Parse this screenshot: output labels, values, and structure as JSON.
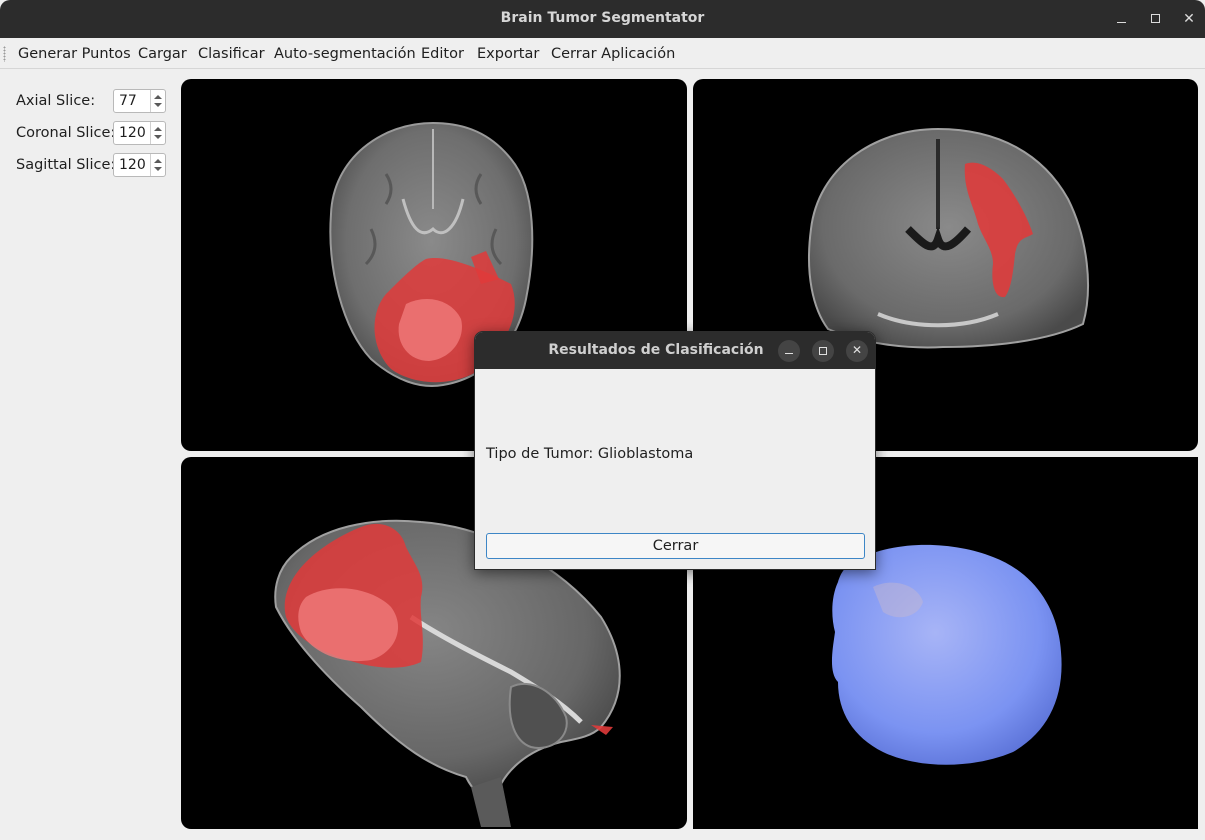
{
  "window": {
    "title": "Brain Tumor Segmentator"
  },
  "menu": {
    "items": [
      "Generar Puntos",
      "Cargar",
      "Clasificar",
      "Auto-segmentación",
      "Editor",
      "Exportar",
      "Cerrar Aplicación"
    ]
  },
  "sidebar": {
    "axial": {
      "label": "Axial Slice:",
      "value": "77"
    },
    "coronal": {
      "label": "Coronal Slice:",
      "value": "120"
    },
    "sagittal": {
      "label": "Sagittal Slice:",
      "value": "120"
    }
  },
  "dialog": {
    "title": "Resultados de Clasificación",
    "result_text": "Tipo de Tumor: Glioblastoma",
    "close_label": "Cerrar"
  },
  "colors": {
    "segmentation_overlay": "#e03a3a",
    "render_surface": "#7b93f2",
    "accent_focus": "#3d86c6"
  }
}
